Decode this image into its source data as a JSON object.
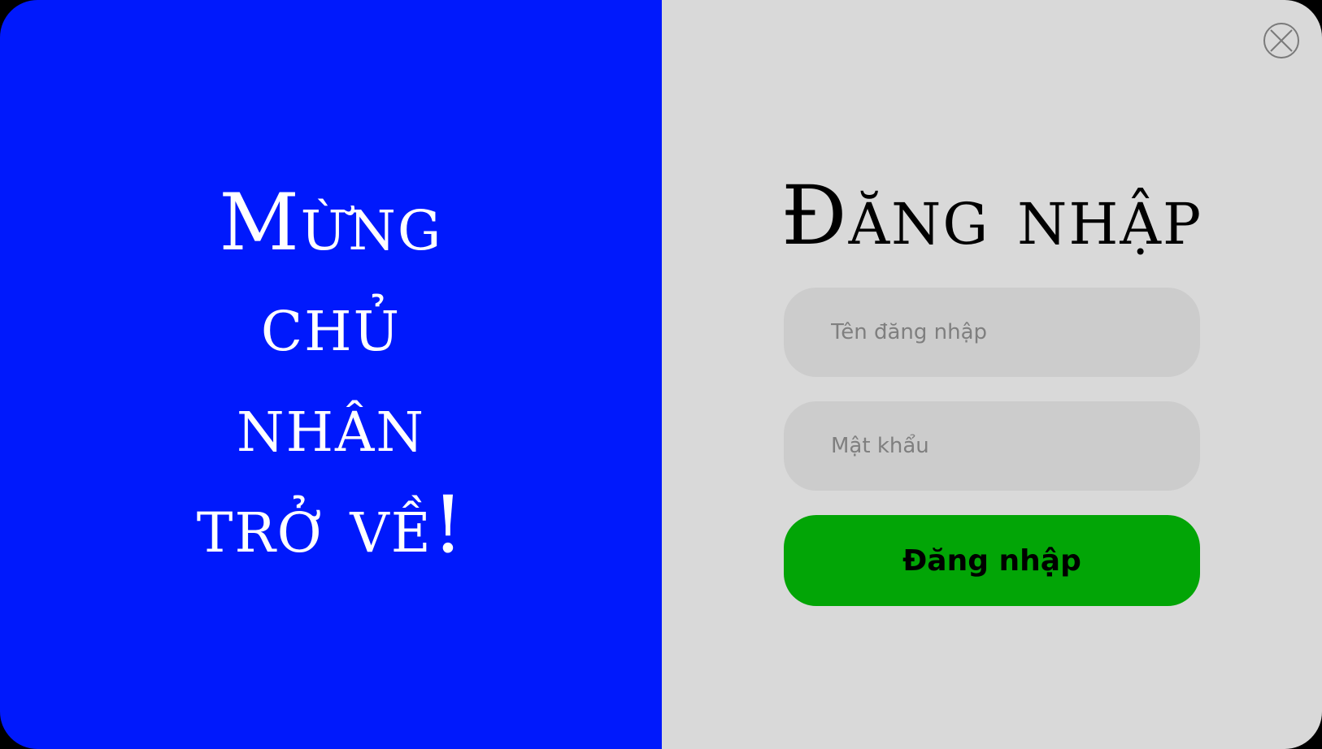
{
  "welcome": {
    "lines": [
      "Mừng",
      "chủ",
      "nhân",
      "trở về!"
    ]
  },
  "login": {
    "title": "Đăng nhập",
    "username_placeholder": "Tên đăng nhập",
    "password_placeholder": "Mật khẩu",
    "submit_label": "Đăng nhập"
  },
  "icons": {
    "close": "close-icon"
  },
  "colors": {
    "left_panel": "#0019fc",
    "right_panel": "#d9d9d9",
    "input_bg": "#cccccc",
    "submit_bg": "#02a506"
  }
}
